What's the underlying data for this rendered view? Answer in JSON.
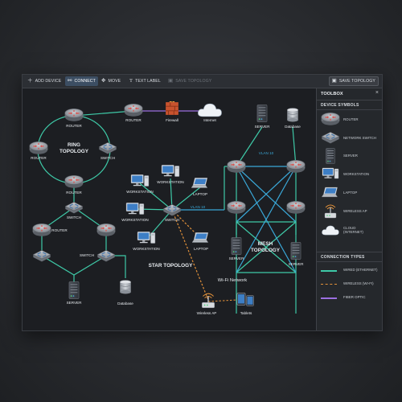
{
  "toolbar": {
    "add_device": "ADD DEVICE",
    "connect": "CONNECT",
    "move": "MOVE",
    "text_label": "TEXT LABEL",
    "save_topology_disabled": "SAVE TOPOLOGY",
    "save_topology": "SAVE TOPOLOGY"
  },
  "toolbox": {
    "title": "TOOLBOX",
    "device_symbols_heading": "DEVICE SYMBOLS",
    "symbols": {
      "router": "ROUTER",
      "switch": "NETWORK SWITCH",
      "server": "SERVER",
      "workstation": "WORKSTATION",
      "laptop": "LAPTOP",
      "ap": "WIRELESS AP",
      "cloud_1": "CLOUD",
      "cloud_2": "(INTERNET)"
    },
    "connection_types_heading": "CONNECTION TYPES",
    "connections": {
      "wired": "WIRED (ETHERNET)",
      "wireless": "WIRELESS (WI-FI)",
      "fiber": "FIBER OPTIC"
    }
  },
  "colors": {
    "wired": "#3ec9a7",
    "wireless": "#e2913a",
    "fiber": "#9b6fe0",
    "vlan": "#3aa8d8",
    "accent": "#3c4e63"
  },
  "canvas": {
    "ring_title_1": "RING",
    "ring_title_2": "TOPOLOGY",
    "star_title": "STAR TOPOLOGY",
    "mesh_title_1": "MESH",
    "mesh_title_2": "TOPOLOGY",
    "wifi_title": "Wi-Fi Network",
    "vlan_label": "VLAN 10",
    "labels": {
      "router": "ROUTER",
      "switch": "SWITCH",
      "firewall": "Firewall",
      "internet": "Internet",
      "server": "SERVER",
      "database": "Database",
      "workstation": "WORKSTATION",
      "laptop": "LAPTOP",
      "wireless_ap": "Wireless AP",
      "tablets": "Tablets"
    }
  }
}
